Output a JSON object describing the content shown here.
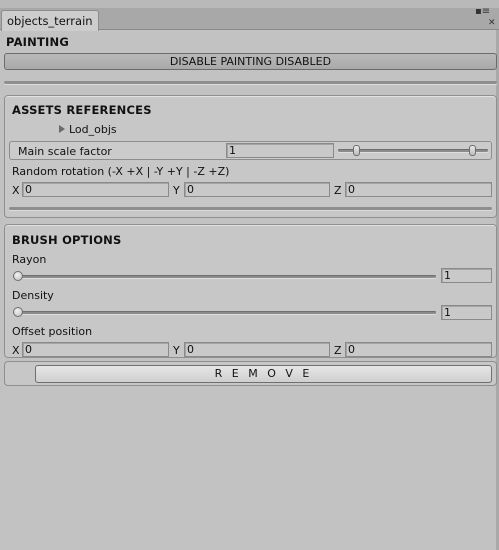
{
  "window": {
    "tab_label": "objects_terrain",
    "menu_icon": "▪≡",
    "close_icon": "✕"
  },
  "painting": {
    "title": "PAINTING",
    "toggle_button": "DISABLE PAINTING DISABLED"
  },
  "assets": {
    "title": "ASSETS REFERENCES",
    "foldout_label": "Lod_objs",
    "main_scale_label": "Main scale factor",
    "main_scale_value": "1",
    "scale_range": [
      0.1,
      0.9
    ],
    "random_rotation_label": "Random rotation (-X +X | -Y +Y | -Z +Z)",
    "rotation": [
      {
        "axis": "X",
        "value": "0"
      },
      {
        "axis": "Y",
        "value": "0"
      },
      {
        "axis": "Z",
        "value": "0"
      }
    ]
  },
  "brush": {
    "title": "BRUSH OPTIONS",
    "rayon_label": "Rayon",
    "rayon_value": "1",
    "rayon_fraction": 0.0,
    "density_label": "Density",
    "density_value": "1",
    "density_fraction": 0.0,
    "offset_label": "Offset position",
    "offset": [
      {
        "axis": "X",
        "value": "0"
      },
      {
        "axis": "Y",
        "value": "0"
      },
      {
        "axis": "Z",
        "value": "0"
      }
    ]
  },
  "remove_button": "R E M O V E"
}
